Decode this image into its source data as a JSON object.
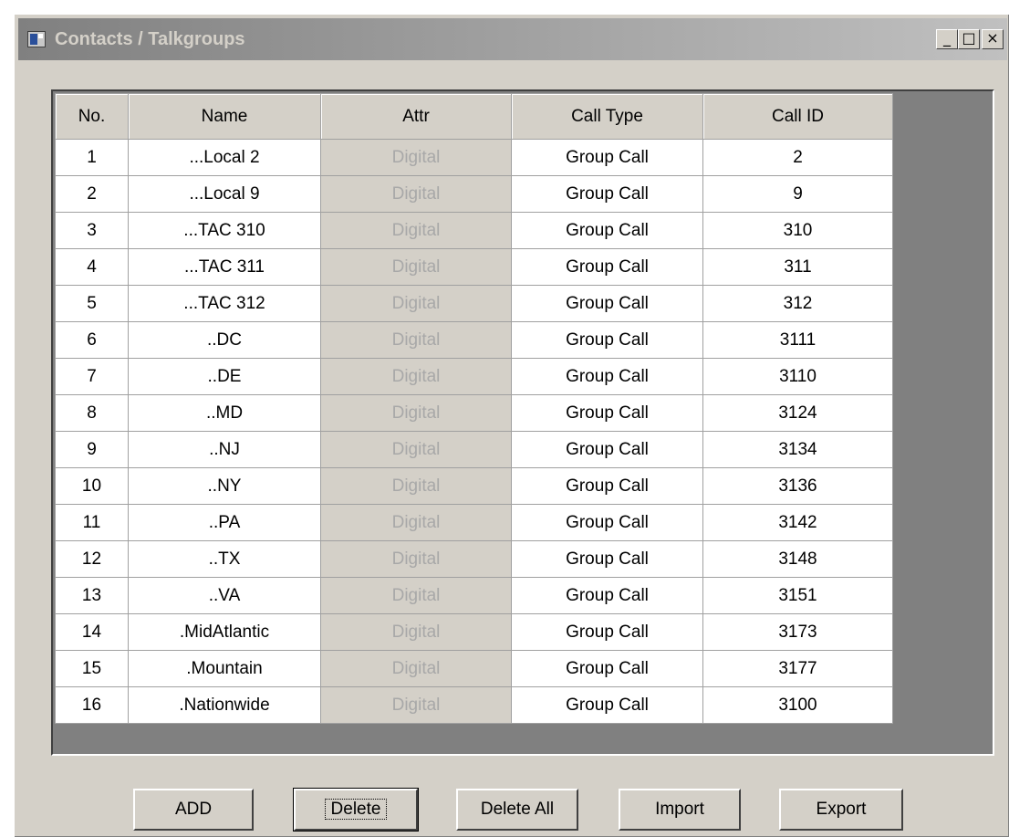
{
  "window": {
    "title": "Contacts / Talkgroups"
  },
  "titlebar_buttons": {
    "minimize": "_",
    "maximize": "□",
    "close": "×"
  },
  "table": {
    "headers": [
      "No.",
      "Name",
      "Attr",
      "Call Type",
      "Call ID"
    ],
    "rows": [
      [
        "1",
        "...Local 2",
        "Digital",
        "Group Call",
        "2"
      ],
      [
        "2",
        "...Local 9",
        "Digital",
        "Group Call",
        "9"
      ],
      [
        "3",
        "...TAC 310",
        "Digital",
        "Group Call",
        "310"
      ],
      [
        "4",
        "...TAC 311",
        "Digital",
        "Group Call",
        "311"
      ],
      [
        "5",
        "...TAC 312",
        "Digital",
        "Group Call",
        "312"
      ],
      [
        "6",
        "..DC",
        "Digital",
        "Group Call",
        "3111"
      ],
      [
        "7",
        "..DE",
        "Digital",
        "Group Call",
        "3110"
      ],
      [
        "8",
        "..MD",
        "Digital",
        "Group Call",
        "3124"
      ],
      [
        "9",
        "..NJ",
        "Digital",
        "Group Call",
        "3134"
      ],
      [
        "10",
        "..NY",
        "Digital",
        "Group Call",
        "3136"
      ],
      [
        "11",
        "..PA",
        "Digital",
        "Group Call",
        "3142"
      ],
      [
        "12",
        "..TX",
        "Digital",
        "Group Call",
        "3148"
      ],
      [
        "13",
        "..VA",
        "Digital",
        "Group Call",
        "3151"
      ],
      [
        "14",
        ".MidAtlantic",
        "Digital",
        "Group Call",
        "3173"
      ],
      [
        "15",
        ".Mountain",
        "Digital",
        "Group Call",
        "3177"
      ],
      [
        "16",
        ".Nationwide",
        "Digital",
        "Group Call",
        "3100"
      ]
    ]
  },
  "buttons": {
    "add": "ADD",
    "delete": "Delete",
    "delete_all": "Delete All",
    "import": "Import",
    "export": "Export"
  },
  "colors": {
    "face": "#d4d0c8",
    "grid_background": "#808080",
    "attr_text": "#a8a8a8"
  }
}
